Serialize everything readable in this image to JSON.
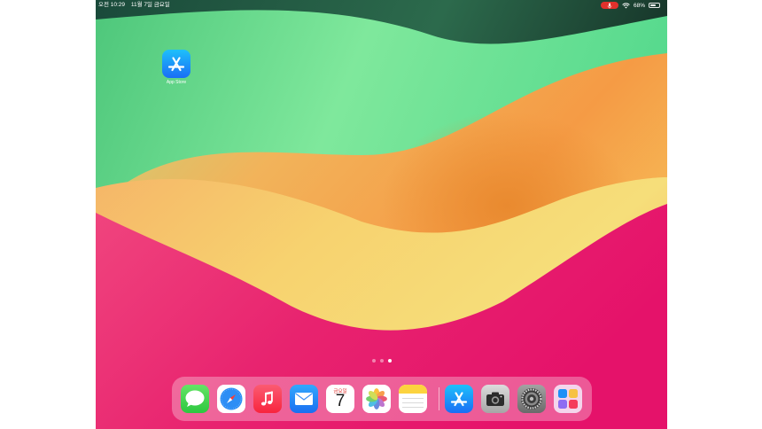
{
  "status_bar": {
    "time": "오전 10:29",
    "date": "11월 7일 금요일",
    "battery_percent": "68%",
    "battery_level": 0.68,
    "icons": [
      "microphone-icon",
      "wifi-icon",
      "battery-icon"
    ]
  },
  "home_screen": {
    "apps": [
      {
        "name": "App Store",
        "icon": "app-store-icon"
      }
    ]
  },
  "page_indicator": {
    "pages": 3,
    "active": 2
  },
  "dock": {
    "apps": [
      {
        "id": "messages",
        "icon": "messages-icon"
      },
      {
        "id": "safari",
        "icon": "safari-icon"
      },
      {
        "id": "music",
        "icon": "music-icon"
      },
      {
        "id": "mail",
        "icon": "mail-icon"
      },
      {
        "id": "calendar",
        "icon": "calendar-icon",
        "weekday": "금요일",
        "day": "7"
      },
      {
        "id": "photos",
        "icon": "photos-icon"
      },
      {
        "id": "notes",
        "icon": "notes-icon"
      }
    ],
    "recent_apps": [
      {
        "id": "app-store",
        "icon": "app-store-icon"
      },
      {
        "id": "camera",
        "icon": "camera-icon"
      },
      {
        "id": "settings",
        "icon": "settings-icon"
      },
      {
        "id": "app-library",
        "icon": "app-library-icon"
      }
    ]
  },
  "colors": {
    "wallpaper_dark_green": "#1d4f3e",
    "wallpaper_green": "#6fe6a0",
    "wallpaper_orange": "#f6a14a",
    "wallpaper_yellow": "#f7d872",
    "wallpaper_pink": "#e8196c",
    "recording_red": "#e0312c"
  }
}
